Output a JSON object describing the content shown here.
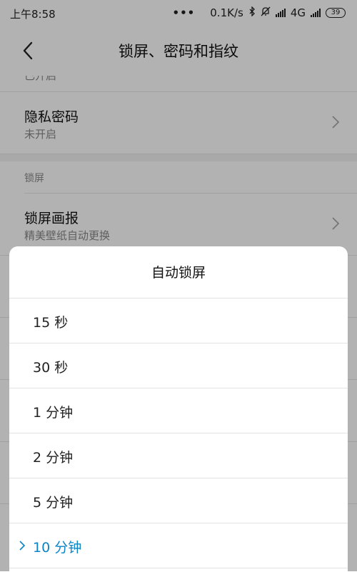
{
  "status_bar": {
    "time": "上午8:58",
    "dots": "•••",
    "speed": "0.1K/s",
    "network": "4G",
    "battery": "39"
  },
  "app_bar": {
    "title": "锁屏、密码和指纹"
  },
  "list": {
    "clipped_sub": "已开启",
    "privacy_password": {
      "title": "隐私密码",
      "sub": "未开启"
    },
    "section_lock": "锁屏",
    "lock_wallpaper": {
      "title": "锁屏画报",
      "sub": "精美壁纸自动更换"
    }
  },
  "dialog": {
    "title": "自动锁屏",
    "options": [
      "15 秒",
      "30 秒",
      "1 分钟",
      "2 分钟",
      "5 分钟",
      "10 分钟"
    ],
    "selected_index": 5
  },
  "colors": {
    "accent": "#0a84c5",
    "overlay": "rgba(0,0,0,0.3)"
  }
}
